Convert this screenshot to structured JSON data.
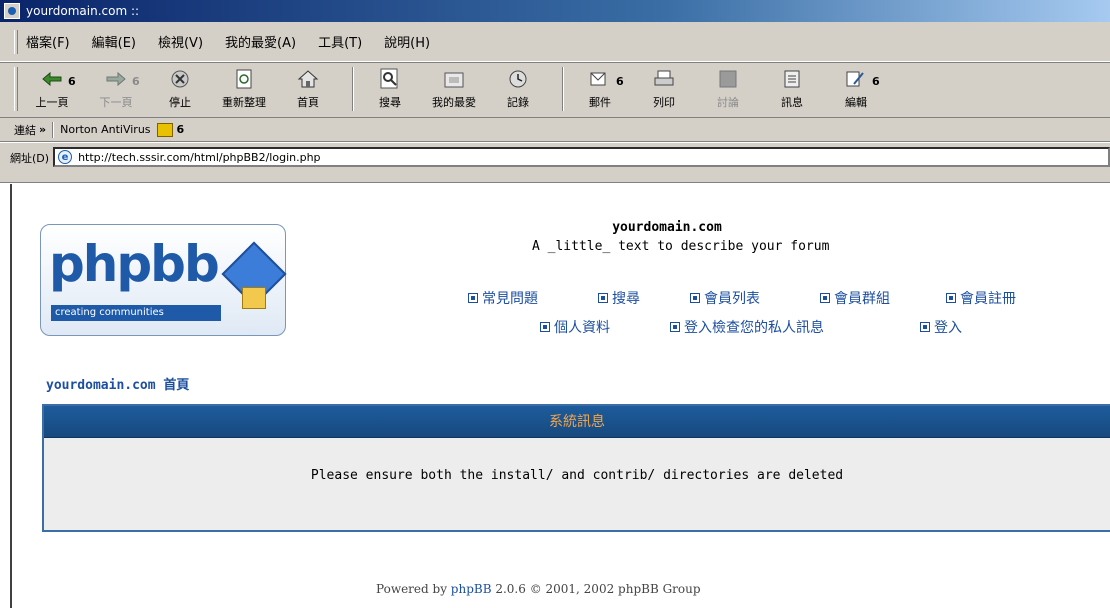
{
  "window": {
    "title": "yourdomain.com ::"
  },
  "menu": [
    "檔案(F)",
    "編輯(E)",
    "檢視(V)",
    "我的最愛(A)",
    "工具(T)",
    "說明(H)"
  ],
  "toolbar": {
    "back_label": "上一頁",
    "back_count": "6",
    "forward_label": "下一頁",
    "forward_count": "6",
    "stop_label": "停止",
    "refresh_label": "重新整理",
    "home_label": "首頁",
    "search_label": "搜尋",
    "favorites_label": "我的最愛",
    "history_label": "記錄",
    "mail_label": "郵件",
    "mail_count": "6",
    "print_label": "列印",
    "discuss_label": "討論",
    "discuss_disabled": true,
    "messenger_label": "訊息",
    "edit_label": "編輯",
    "edit_count": "6"
  },
  "linksbar": {
    "label": "連結",
    "chevron": "»",
    "norton": "Norton AntiVirus",
    "norton_count": "6"
  },
  "address": {
    "label": "網址(D)",
    "url": "http://tech.sssir.com/html/phpBB2/login.php"
  },
  "logo": {
    "name": "phpbb",
    "tagline": "creating communities"
  },
  "site": {
    "title": "yourdomain.com",
    "description": "A _little_ text to describe your forum"
  },
  "nav": {
    "faq": "常見問題",
    "search": "搜尋",
    "memberlist": "會員列表",
    "usergroups": "會員群組",
    "register": "會員註冊",
    "profile": "個人資料",
    "login_pm": "登入檢查您的私人訊息",
    "login": "登入"
  },
  "breadcrumb": "yourdomain.com 首頁",
  "message": {
    "header": "系統訊息",
    "body": "Please ensure both the install/ and contrib/ directories are deleted"
  },
  "footer": {
    "prefix": "Powered by ",
    "link": "phpBB",
    "suffix": " 2.0.6 © 2001, 2002 phpBB Group"
  }
}
